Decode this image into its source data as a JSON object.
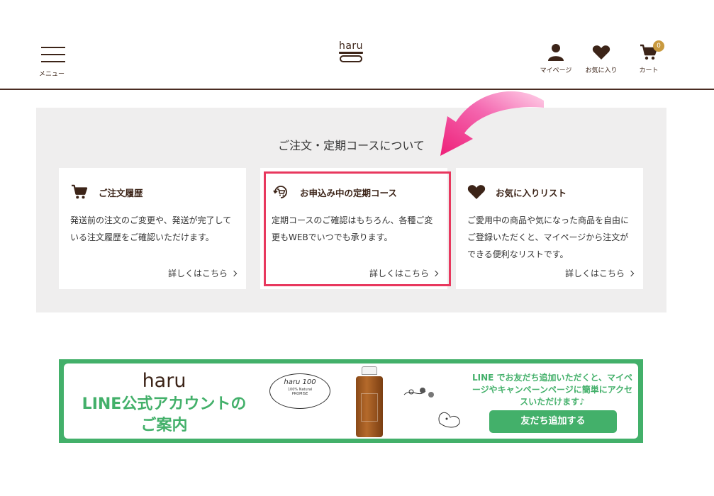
{
  "header": {
    "menu_label": "メニュー",
    "logo_text": "haru",
    "nav": [
      {
        "label": "マイページ",
        "icon": "person-icon"
      },
      {
        "label": "お気に入り",
        "icon": "heart-icon"
      },
      {
        "label": "カート",
        "icon": "cart-icon",
        "badge": "0"
      }
    ]
  },
  "section": {
    "title": "ご注文・定期コースについて",
    "cards": [
      {
        "title": "ご注文履歴",
        "icon": "cart-icon",
        "body": "発送前の注文のご変更や、発送が完了している注文履歴をご確認いただけます。",
        "more": "詳しくはこちら"
      },
      {
        "title": "お申込み中の定期コース",
        "icon": "subscription-cart-icon",
        "body": "定期コースのご確認はもちろん、各種ご変更もWEBでいつでも承ります。",
        "more": "詳しくはこちら"
      },
      {
        "title": "お気に入りリスト",
        "icon": "heart-icon",
        "body": "ご愛用中の商品や気になった商品を自由にご登録いただくと、マイページから注文ができる便利なリストです。",
        "more": "詳しくはこちら"
      }
    ]
  },
  "banner": {
    "brand": "haru",
    "title_line1": "LINE公式アカウントの",
    "title_line2": "ご案内",
    "stamp_main": "haru 100",
    "stamp_sub1": "100% Natural",
    "stamp_sub2": "PROMISE",
    "message": "LINE でお友だち追加いただくと、マイページやキャンペーンページに簡単にアクセスいただけます♪",
    "button": "友だち追加する"
  },
  "colors": {
    "brand_brown": "#3c2418",
    "line_green": "#43b06a",
    "highlight_red": "#e8385e",
    "arrow_pink": "#f23a8a",
    "badge_gold": "#c99a3f"
  }
}
